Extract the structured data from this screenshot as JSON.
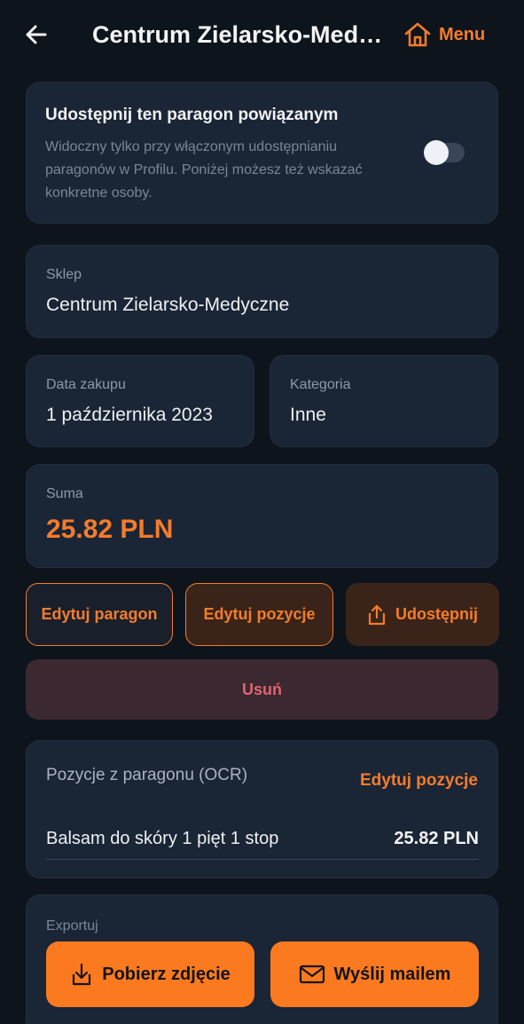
{
  "header": {
    "title": "Centrum Zielarsko-Medyczne",
    "menu_label": "Menu"
  },
  "share_card": {
    "title": "Udostępnij ten paragon powiązanym",
    "description": "Widoczny tylko przy włączonym udostępnianiu paragonów w Profilu. Poniżej możesz też wskazać konkretne osoby.",
    "toggle_on": false
  },
  "shop": {
    "label": "Sklep",
    "value": "Centrum Zielarsko-Medyczne"
  },
  "purchase_date": {
    "label": "Data zakupu",
    "value": "1 października 2023"
  },
  "category": {
    "label": "Kategoria",
    "value": "Inne"
  },
  "sum": {
    "label": "Suma",
    "value": "25.82 PLN"
  },
  "actions": {
    "edit_receipt": "Edytuj paragon",
    "edit_items": "Edytuj pozycje",
    "share": "Udostępnij",
    "delete": "Usuń"
  },
  "ocr": {
    "title": "Pozycje z paragonu (OCR)",
    "edit_link": "Edytuj pozycje",
    "items": [
      {
        "name": "Balsam do skóry 1 pięt 1 stop",
        "price": "25.82 PLN"
      }
    ]
  },
  "export": {
    "label": "Exportuj",
    "download_label": "Pobierz zdjęcie",
    "email_label": "Wyślij mailem"
  },
  "colors": {
    "accent": "#f47c2c",
    "background": "#0e141b",
    "card": "#1a2535",
    "danger_text": "#e36272",
    "primary_button": "#fb7a1f"
  }
}
